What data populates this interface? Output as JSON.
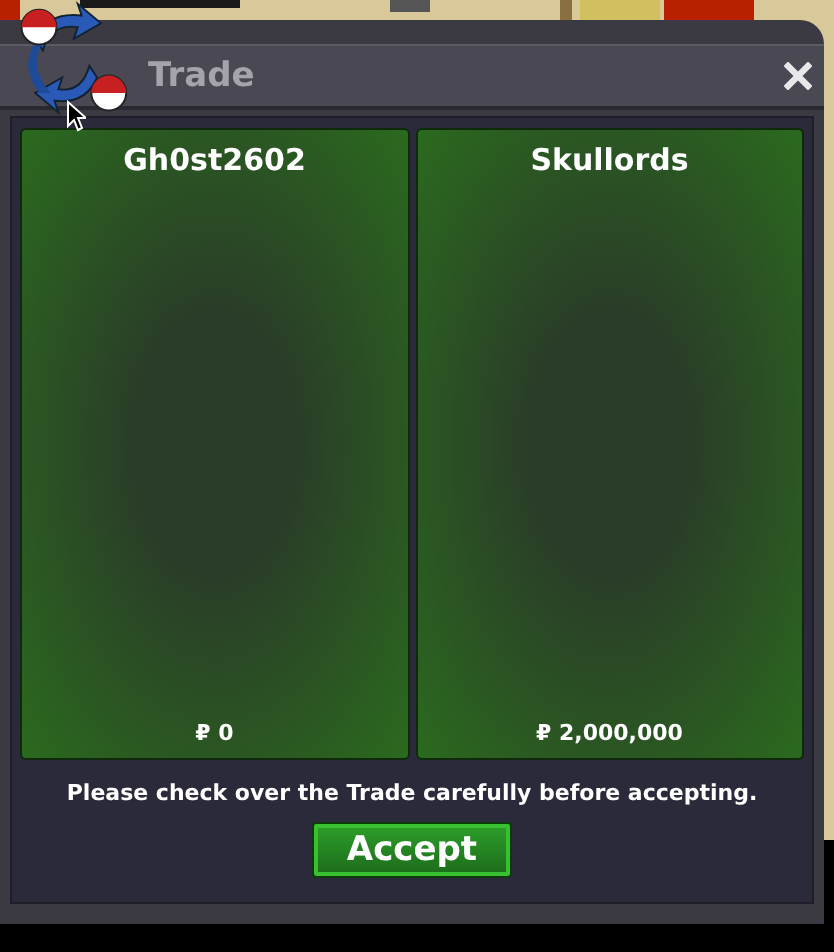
{
  "window": {
    "title": "Trade"
  },
  "offers": [
    {
      "player": "Gh0st2602",
      "money": "₽ 0"
    },
    {
      "player": "Skullords",
      "money": "₽ 2,000,000"
    }
  ],
  "message": "Please check over the Trade carefully before accepting.",
  "buttons": [
    "Accept"
  ]
}
